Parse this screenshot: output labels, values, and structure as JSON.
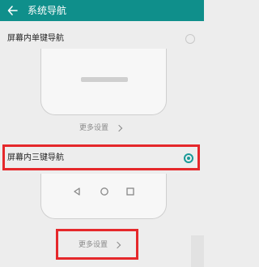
{
  "header": {
    "title": "系统导航"
  },
  "options": [
    {
      "label": "屏幕内单键导航",
      "checked": false,
      "more": "更多设置"
    },
    {
      "label": "屏幕内三键导航",
      "checked": true,
      "more": "更多设置"
    }
  ],
  "colors": {
    "header_bg": "#0f8f8b",
    "accent": "#1a9a98",
    "highlight": "#e5282b"
  }
}
